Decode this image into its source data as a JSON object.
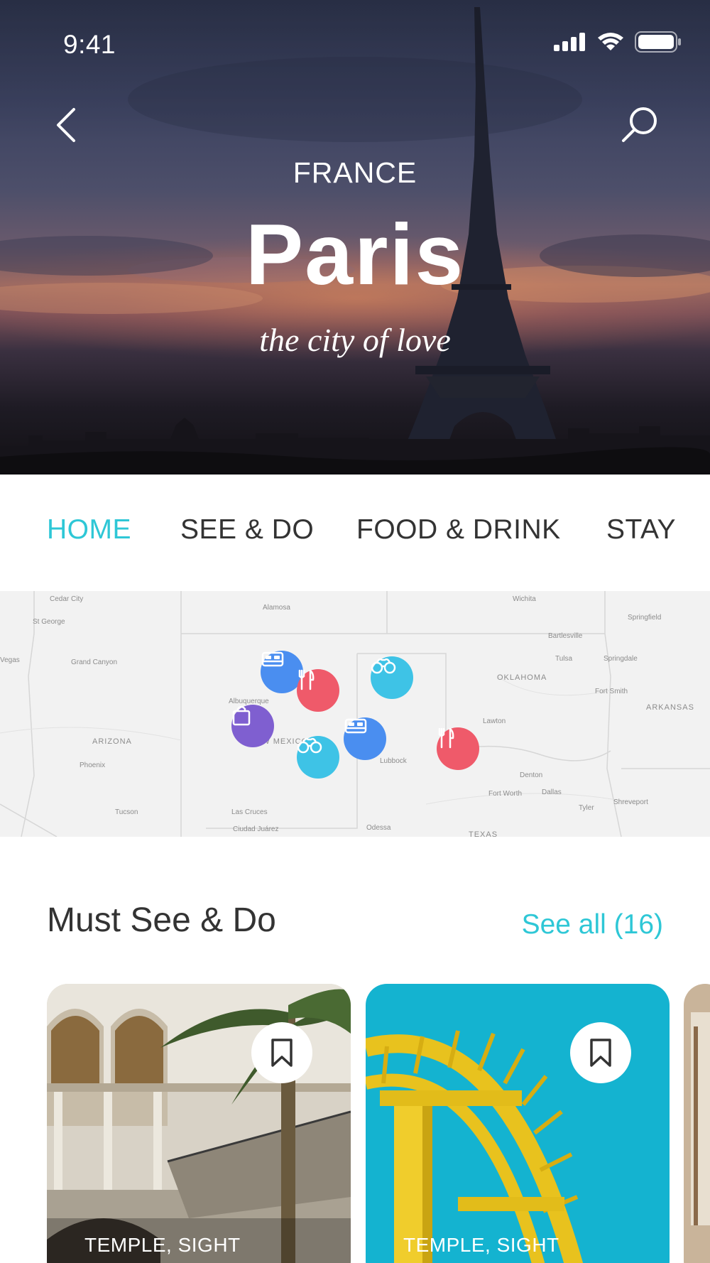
{
  "status_bar": {
    "time": "9:41"
  },
  "hero": {
    "country": "FRANCE",
    "city": "Paris",
    "tagline": "the city of love"
  },
  "tabs": [
    {
      "label": "HOME",
      "active": true
    },
    {
      "label": "SEE & DO",
      "active": false
    },
    {
      "label": "FOOD & DRINK",
      "active": false
    },
    {
      "label": "STAY",
      "active": false
    }
  ],
  "map": {
    "labels": [
      "Cedar City",
      "St George",
      "Vegas",
      "Grand Canyon",
      "ARIZONA",
      "Phoenix",
      "Tucson",
      "Alamosa",
      "Albuquerque",
      "NEW MEXICO",
      "Las Cruces",
      "Ciudad Juárez",
      "Wichita",
      "Springfield",
      "Bartlesville",
      "Tulsa",
      "Springdale",
      "OKLAHOMA",
      "Fort Smith",
      "ARKANSAS",
      "Lawton",
      "Lubbock",
      "Denton",
      "Fort Worth",
      "Dallas",
      "Tyler",
      "Shreveport",
      "Odessa",
      "TEXAS"
    ],
    "pins": [
      {
        "type": "stay",
        "icon": "bed-icon",
        "color": "#4a8ef0"
      },
      {
        "type": "food",
        "icon": "fork-knife-icon",
        "color": "#ef5a6a"
      },
      {
        "type": "see",
        "icon": "binoculars-icon",
        "color": "#3ec3e6"
      },
      {
        "type": "shop",
        "icon": "shopping-bag-icon",
        "color": "#7f5fd0"
      },
      {
        "type": "see",
        "icon": "binoculars-icon",
        "color": "#3ec3e6"
      },
      {
        "type": "stay",
        "icon": "bed-icon",
        "color": "#4a8ef0"
      },
      {
        "type": "food",
        "icon": "fork-knife-icon",
        "color": "#ef5a6a"
      }
    ]
  },
  "section": {
    "title": "Must See & Do",
    "see_all": "See all (16)"
  },
  "cards": [
    {
      "category": "TEMPLE, SIGHT",
      "image": "courtyard-photo"
    },
    {
      "category": "TEMPLE, SIGHT",
      "image": "yellow-ride-photo"
    }
  ],
  "colors": {
    "accent": "#2ec7d6",
    "text_dark": "#333333",
    "pin_stay": "#4a8ef0",
    "pin_food": "#ef5a6a",
    "pin_see": "#3ec3e6",
    "pin_shop": "#7f5fd0"
  }
}
